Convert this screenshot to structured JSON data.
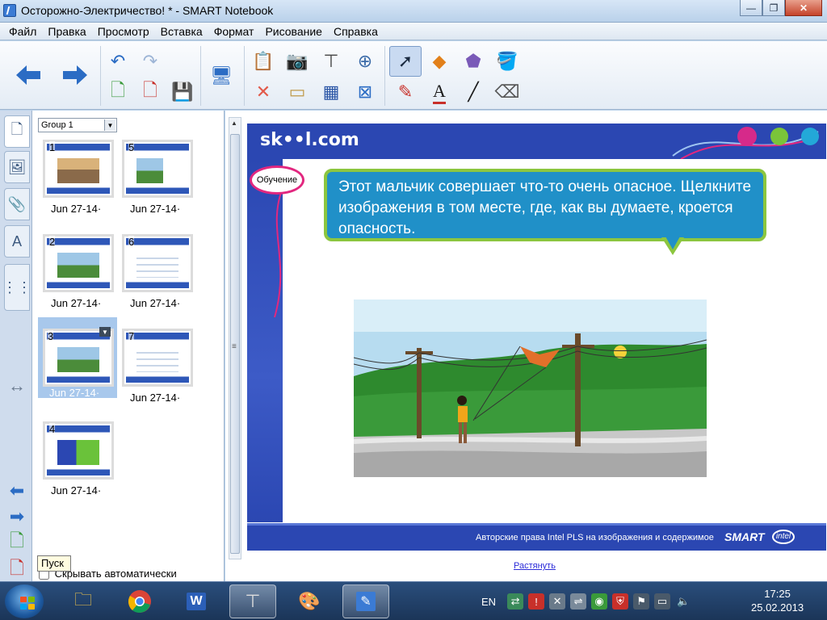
{
  "window": {
    "title": "Осторожно-Электричество! * - SMART Notebook",
    "minimize": "—",
    "maximize": "❐",
    "close": "✕"
  },
  "menu": [
    "Файл",
    "Правка",
    "Просмотр",
    "Вставка",
    "Формат",
    "Рисование",
    "Справка"
  ],
  "sorter": {
    "group": "Group 1",
    "pages": [
      {
        "num": "1",
        "date": "Jun  27-14·"
      },
      {
        "num": "2",
        "date": "Jun  27-14·"
      },
      {
        "num": "3",
        "date": "Jun  27-14·"
      },
      {
        "num": "4",
        "date": "Jun  27-14·"
      },
      {
        "num": "5",
        "date": "Jun  27-14·"
      },
      {
        "num": "6",
        "date": "Jun  27-14·"
      },
      {
        "num": "7",
        "date": "Jun  27-14·"
      }
    ],
    "autohide": "Скрывать автоматически",
    "tooltip": "Пуск"
  },
  "slide": {
    "logo": "sk••l.com",
    "badge": "Обучение",
    "speech": "Этот мальчик совершает что-то очень опасное. Щелкните изображения в том месте, где, как вы думаете, кроется опасность.",
    "copyright": "Авторские права Intel PLS на изображения и содержимое",
    "smart": "SMART",
    "intel": "intel"
  },
  "stretch_link": "Растянуть",
  "tray": {
    "lang": "EN",
    "time": "17:25",
    "date": "25.02.2013"
  }
}
